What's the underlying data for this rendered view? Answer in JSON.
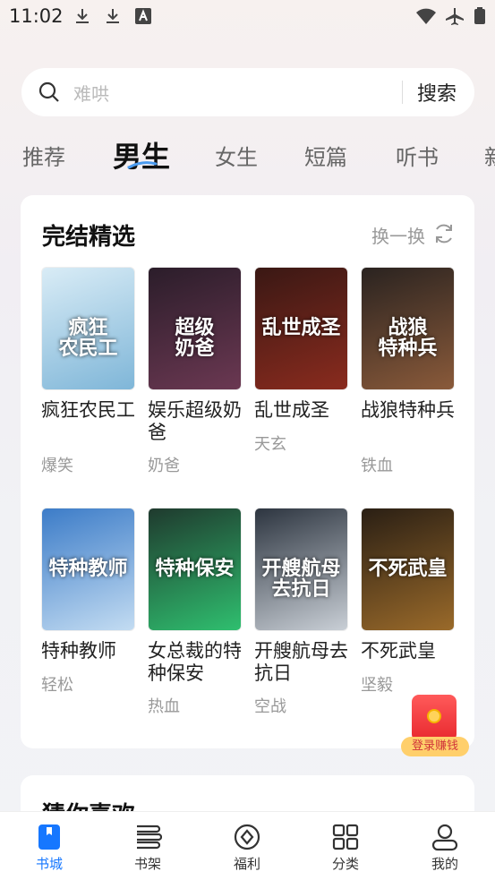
{
  "status": {
    "time": "11:02"
  },
  "search": {
    "placeholder": "难哄",
    "button": "搜索"
  },
  "tabs": [
    "推荐",
    "男生",
    "女生",
    "短篇",
    "听书",
    "新"
  ],
  "active_tab": "男生",
  "section": {
    "title": "完结精选",
    "refresh_label": "换一换"
  },
  "books": [
    {
      "name": "疯狂农民工",
      "tag": "爆笑",
      "cover_text": "疯狂\n农民工",
      "cover_colors": [
        "#d9ecf6",
        "#7fb6d8"
      ]
    },
    {
      "name": "娱乐超级奶爸",
      "tag": "奶爸",
      "cover_text": "超级\n奶爸",
      "cover_colors": [
        "#2b1d2a",
        "#6b3852"
      ]
    },
    {
      "name": "乱世成圣",
      "tag": "天玄",
      "cover_text": "乱世成圣",
      "cover_colors": [
        "#3a1814",
        "#8a2b1e"
      ]
    },
    {
      "name": "战狼特种兵",
      "tag": "铁血",
      "cover_text": "战狼\n特种兵",
      "cover_colors": [
        "#2a2320",
        "#8a5a3a"
      ]
    },
    {
      "name": "特种教师",
      "tag": "轻松",
      "cover_text": "特种教师",
      "cover_colors": [
        "#3c7cc8",
        "#c3dcf2"
      ]
    },
    {
      "name": "女总裁的特种保安",
      "tag": "热血",
      "cover_text": "特种保安",
      "cover_colors": [
        "#1f3a2e",
        "#2fbf6f"
      ]
    },
    {
      "name": "开艘航母去抗日",
      "tag": "空战",
      "cover_text": "开艘航母\n去抗日",
      "cover_colors": [
        "#2d3540",
        "#c9cfd6"
      ]
    },
    {
      "name": "不死武皇",
      "tag": "坚毅",
      "cover_text": "不死武皇",
      "cover_colors": [
        "#2a1f14",
        "#9a6a2a"
      ]
    }
  ],
  "redpacket": {
    "label": "登录赚钱"
  },
  "section2": {
    "title": "猜你喜欢"
  },
  "bottom_nav": [
    {
      "label": "书城",
      "icon": "bookstore-icon",
      "active": true
    },
    {
      "label": "书架",
      "icon": "bookshelf-icon",
      "active": false
    },
    {
      "label": "福利",
      "icon": "welfare-icon",
      "active": false
    },
    {
      "label": "分类",
      "icon": "category-icon",
      "active": false
    },
    {
      "label": "我的",
      "icon": "profile-icon",
      "active": false
    }
  ],
  "colors": {
    "accent": "#1677ff",
    "redpacket": "#e8282e",
    "redpacket_label": "#ffcf6b"
  }
}
